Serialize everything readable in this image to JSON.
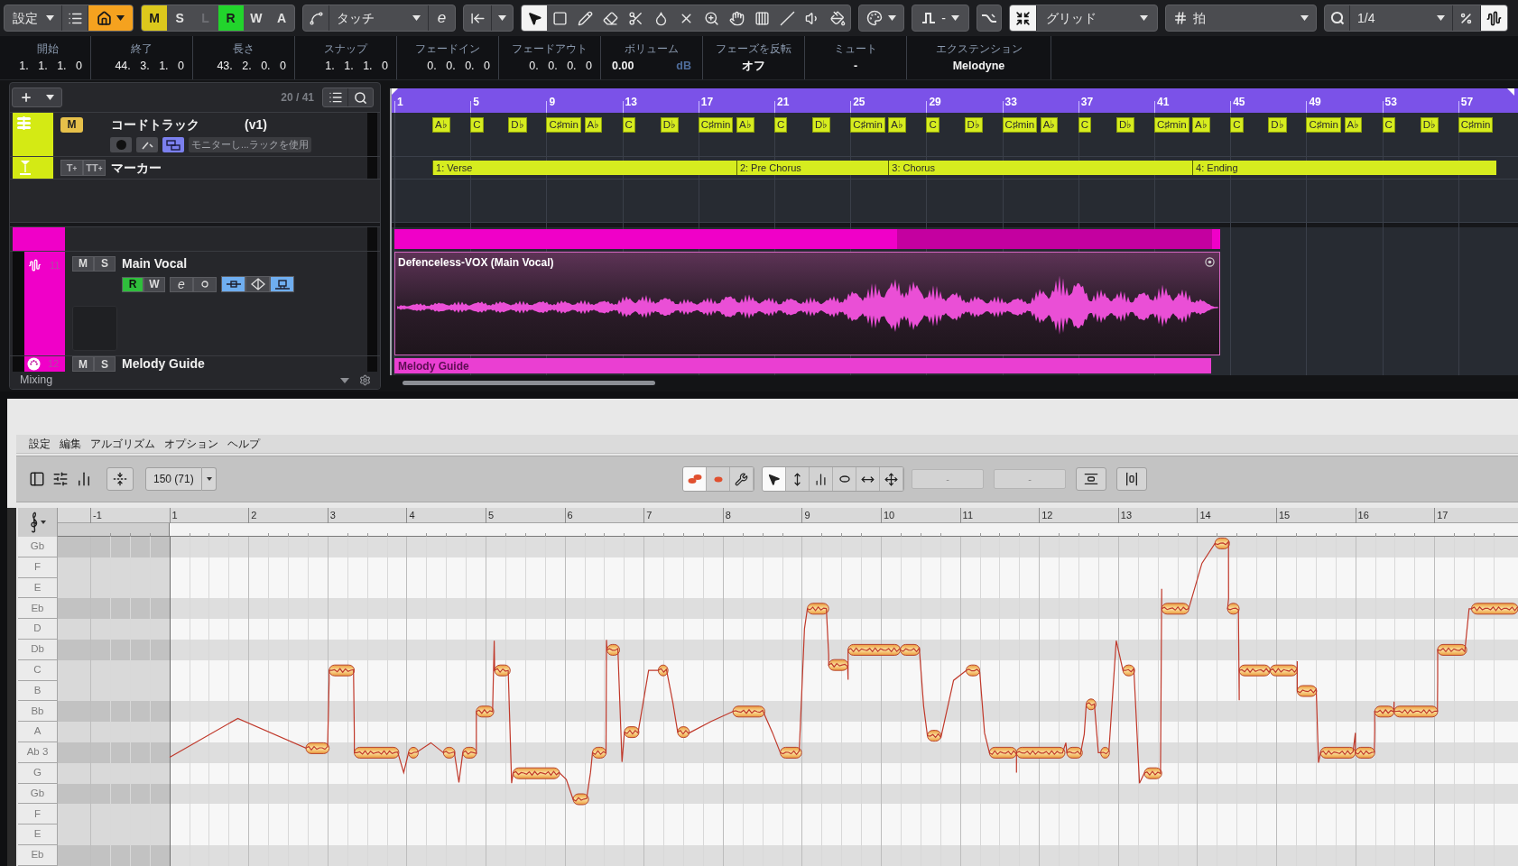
{
  "toolbar": {
    "settings_menu": "設定",
    "modes": [
      {
        "label": "M",
        "on": true,
        "disabled": false,
        "color": "#dcc81c"
      },
      {
        "label": "S",
        "on": false,
        "disabled": false
      },
      {
        "label": "L",
        "on": false,
        "disabled": true
      },
      {
        "label": "R",
        "on": true,
        "disabled": false,
        "color": "#22d42c"
      },
      {
        "label": "W",
        "on": false,
        "disabled": false
      },
      {
        "label": "A",
        "on": false,
        "disabled": false
      }
    ],
    "automation_mode": "タッチ",
    "edit_glyph": "e",
    "tools": [
      {
        "selected": true
      },
      {
        "selected": false
      },
      {
        "selected": false
      },
      {
        "selected": false
      },
      {
        "selected": false
      },
      {
        "selected": false
      },
      {
        "selected": false
      },
      {
        "selected": false
      },
      {
        "selected": false
      },
      {
        "selected": false
      },
      {
        "selected": false
      },
      {
        "selected": false
      },
      {
        "selected": false
      }
    ],
    "step_value": "-",
    "snap": {
      "on": true,
      "label": "グリッド"
    },
    "grid_type": "拍",
    "quantize": "1/4",
    "quantize_tiles": [
      {
        "on": false
      },
      {
        "on": true
      }
    ]
  },
  "info_line": [
    {
      "label": "開始",
      "value": "1. 1. 1. 0",
      "kind": "position"
    },
    {
      "label": "終了",
      "value": "44. 3. 1. 0",
      "kind": "position"
    },
    {
      "label": "長さ",
      "value": "43. 2. 0. 0",
      "kind": "position"
    },
    {
      "label": "スナップ",
      "value": "1. 1. 1. 0",
      "kind": "position"
    },
    {
      "label": "フェードイン",
      "value": "0. 0. 0. 0",
      "kind": "position"
    },
    {
      "label": "フェードアウト",
      "value": "0. 0. 0. 0",
      "kind": "position"
    },
    {
      "label": "ボリューム",
      "value": "0.00",
      "unit": "dB",
      "kind": "volume"
    },
    {
      "label": "フェーズを反転",
      "value": "オフ",
      "kind": "text"
    },
    {
      "label": "ミュート",
      "value": "-",
      "kind": "text"
    },
    {
      "label": "エクステンション",
      "value": "Melodyne",
      "kind": "text"
    }
  ],
  "track_list": {
    "count": "20 / 41",
    "footer": "Mixing",
    "tracks": [
      {
        "kind": "chord",
        "name": "コードトラック",
        "version": "(v1)",
        "color": "#d4ea14",
        "mute": {
          "label": "M",
          "on": true
        },
        "buttons": [
          {
            "on": false
          },
          {
            "on": false
          },
          {
            "on": true
          }
        ],
        "monitor_label": "モニターし...ラックを使用"
      },
      {
        "kind": "marker",
        "name": "マーカー",
        "color": "#d4ea14",
        "buttons": [
          "T$_{+}$",
          "TT$_{+}$"
        ]
      },
      {
        "kind": "folder",
        "color": "#f000c8"
      },
      {
        "kind": "audio",
        "number": "11",
        "name": "Main Vocal",
        "color": "#f000c8",
        "mute": {
          "label": "M",
          "on": false
        },
        "solo": {
          "label": "S",
          "on": false
        },
        "read": {
          "label": "R",
          "on": true
        },
        "write": {
          "label": "W",
          "on": false
        },
        "edit_glyph": "e",
        "buttons": [
          {
            "on": true
          },
          {
            "on": false
          },
          {
            "on": true
          }
        ]
      },
      {
        "kind": "instrument",
        "number": "12",
        "name": "Melody Guide",
        "color": "#f000c8",
        "mute": {
          "label": "M",
          "on": false
        },
        "solo": {
          "label": "S",
          "on": false
        }
      }
    ]
  },
  "timeline": {
    "ruler": [
      "1",
      "5",
      "9",
      "13",
      "17",
      "21",
      "25",
      "29",
      "33",
      "37",
      "41",
      "45",
      "49",
      "53",
      "57"
    ],
    "chords": [
      "A♭",
      "C",
      "D♭",
      "C♯min",
      "A♭",
      "C",
      "D♭",
      "C♯min",
      "A♭",
      "C",
      "D♭",
      "C♯min",
      "A♭",
      "C",
      "D♭",
      "C♯min",
      "A♭",
      "C",
      "D♭",
      "C♯min",
      "A♭",
      "C",
      "D♭",
      "C♯min",
      "A♭",
      "C",
      "D♭",
      "C♯min"
    ],
    "markers": [
      "1: Verse",
      "2: Pre Chorus",
      "3: Chorus",
      "4: Ending"
    ],
    "audio_event": {
      "title": "Defenceless-VOX (Main Vocal)"
    },
    "midi_event": {
      "title": "Melody Guide"
    }
  },
  "melodyne": {
    "menu": [
      "設定",
      "編集",
      "アルゴリズム",
      "オプション",
      "ヘルプ"
    ],
    "tempo": "150 (71)",
    "note_buttons": [
      {
        "selected": true
      },
      {
        "selected": false
      },
      {
        "selected": false
      }
    ],
    "tools": [
      {
        "selected": true
      },
      {
        "selected": false
      },
      {
        "selected": false
      },
      {
        "selected": false
      },
      {
        "selected": false
      },
      {
        "selected": false
      }
    ],
    "fields": [
      "-",
      "-"
    ],
    "ruler": [
      "-1",
      "1",
      "2",
      "3",
      "4",
      "5",
      "6",
      "7",
      "8",
      "9",
      "10",
      "11",
      "12",
      "13",
      "14",
      "15",
      "16",
      "17"
    ],
    "pitch_rows": [
      {
        "label": "Gb",
        "shaded": true
      },
      {
        "label": "F",
        "shaded": false
      },
      {
        "label": "E",
        "shaded": false
      },
      {
        "label": "Eb",
        "shaded": true
      },
      {
        "label": "D",
        "shaded": false
      },
      {
        "label": "Db",
        "shaded": true
      },
      {
        "label": "C",
        "shaded": false
      },
      {
        "label": "B",
        "shaded": false
      },
      {
        "label": "Bb",
        "shaded": true
      },
      {
        "label": "A",
        "shaded": false
      },
      {
        "label": "Ab 3",
        "shaded": true
      },
      {
        "label": "G",
        "shaded": false
      },
      {
        "label": "Gb",
        "shaded": true
      },
      {
        "label": "F",
        "shaded": false
      },
      {
        "label": "E",
        "shaded": false
      },
      {
        "label": "Eb",
        "shaded": true
      }
    ]
  }
}
